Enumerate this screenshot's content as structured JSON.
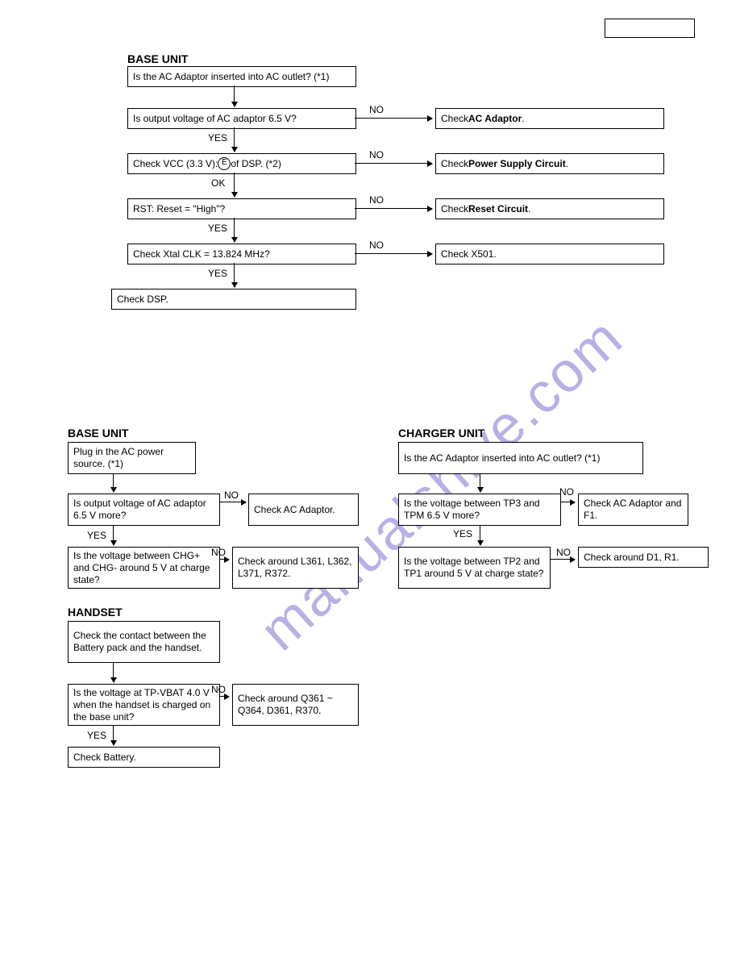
{
  "labels": {
    "yes": "YES",
    "no": "NO",
    "ok": "OK"
  },
  "topright": "",
  "section1": {
    "title": "BASE UNIT",
    "n1": "Is the AC Adaptor inserted into AC outlet? (*1)",
    "n2": "Is output voltage of AC adaptor 6.5 V?",
    "n2no_pre": "Check ",
    "n2no_b": "AC Adaptor",
    "n2no_post": ".",
    "n3_pre": "Check VCC (3.3 V): ",
    "n3_post": " of DSP. (*2)",
    "n3_circle": "E",
    "n3no_pre": "Check ",
    "n3no_b": "Power Supply Circuit",
    "n3no_post": ".",
    "n4": "RST: Reset = \"High\"?",
    "n4no_pre": "Check ",
    "n4no_b": "Reset Circuit",
    "n4no_post": ".",
    "n5": "Check Xtal CLK = 13.824 MHz?",
    "n5no": "Check X501.",
    "n6": "Check DSP."
  },
  "section2": {
    "title": "BASE UNIT",
    "n1": "Plug in the AC power source. (*1)",
    "n2": "Is output voltage of AC adaptor 6.5 V more?",
    "n2no": "Check AC Adaptor.",
    "n3": "Is the voltage between CHG+ and CHG- around 5 V at charge state?",
    "n3no": "Check around L361, L362, L371, R372."
  },
  "section3": {
    "title": "HANDSET",
    "n1": "Check the contact between the Battery pack and the handset.",
    "n2": "Is the voltage at TP-VBAT 4.0 V when the handset is charged on the base unit?",
    "n2no": "Check around Q361 ~ Q364, D361, R370.",
    "n3": "Check Battery."
  },
  "section4": {
    "title": "CHARGER UNIT",
    "n1": "Is the AC Adaptor inserted  into AC outlet? (*1)",
    "n2": "Is the voltage between TP3 and TPM 6.5 V more?",
    "n2no": "Check AC Adaptor and F1.",
    "n3": "Is the voltage between TP2 and TP1 around 5 V at charge state?",
    "n3no": "Check around D1, R1."
  },
  "watermark": "manualshive.com"
}
